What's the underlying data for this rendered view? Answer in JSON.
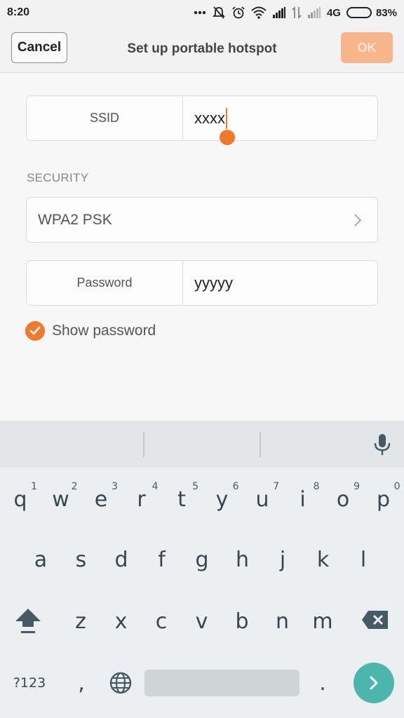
{
  "status_bar": {
    "time": "8:20",
    "network": "4G",
    "battery_percent": "83%",
    "battery_level": 0.83,
    "icons": [
      "more-dots-icon",
      "notifications-off-icon",
      "alarm-icon",
      "wifi-icon",
      "signal-icon",
      "data-arrows-icon",
      "signal-weak-icon",
      "battery-icon"
    ]
  },
  "header": {
    "cancel_label": "Cancel",
    "title": "Set up portable hotspot",
    "ok_label": "OK"
  },
  "form": {
    "ssid_label": "SSID",
    "ssid_value": "xxxx",
    "security_label": "SECURITY",
    "security_value": "WPA2 PSK",
    "password_label": "Password",
    "password_value": "yyyyy",
    "show_password_label": "Show password",
    "show_password_checked": true
  },
  "colors": {
    "accent": "#f07a2c",
    "ok_disabled": "#f8b48a",
    "enter_key": "#4db6ac"
  },
  "keyboard": {
    "row1": [
      {
        "key": "q",
        "hint": "1"
      },
      {
        "key": "w",
        "hint": "2"
      },
      {
        "key": "e",
        "hint": "3"
      },
      {
        "key": "r",
        "hint": "4"
      },
      {
        "key": "t",
        "hint": "5"
      },
      {
        "key": "y",
        "hint": "6"
      },
      {
        "key": "u",
        "hint": "7"
      },
      {
        "key": "i",
        "hint": "8"
      },
      {
        "key": "o",
        "hint": "9"
      },
      {
        "key": "p",
        "hint": "0"
      }
    ],
    "row2": [
      "a",
      "s",
      "d",
      "f",
      "g",
      "h",
      "j",
      "k",
      "l"
    ],
    "row3": [
      "z",
      "x",
      "c",
      "v",
      "b",
      "n",
      "m"
    ],
    "symbols_label": "?123",
    "comma": ",",
    "period": "."
  }
}
